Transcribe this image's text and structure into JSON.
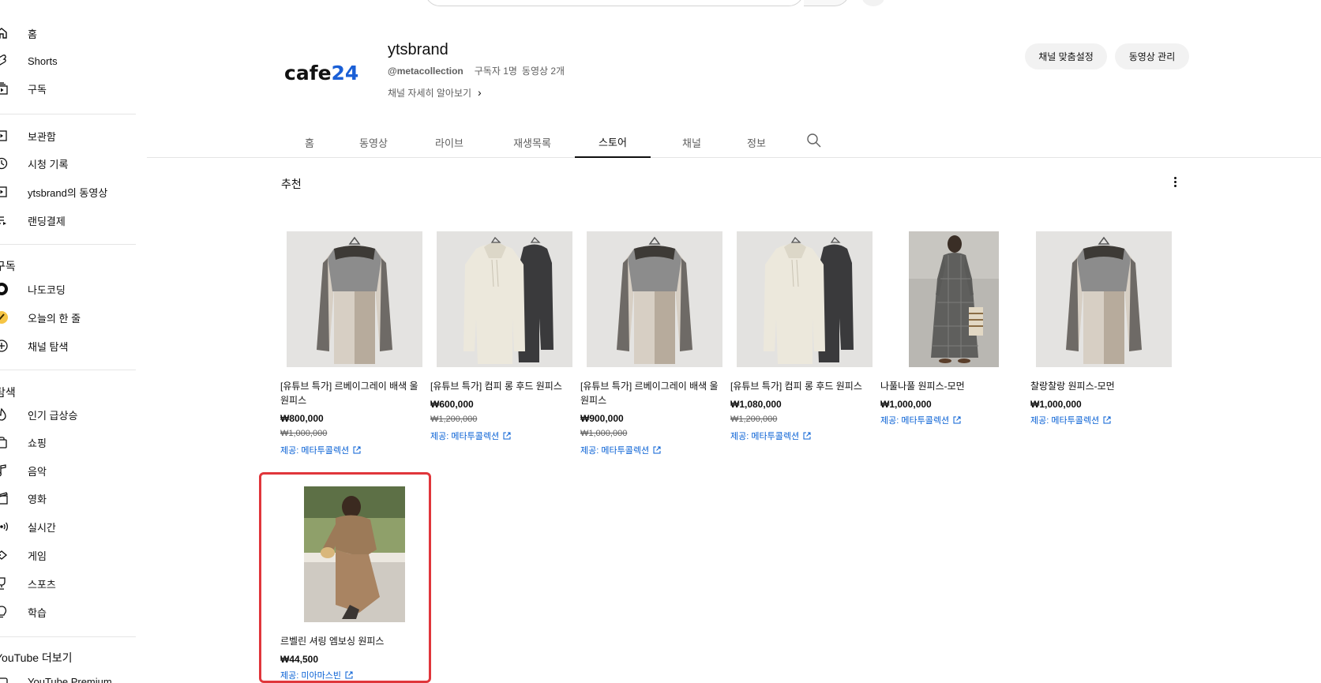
{
  "sidebar": {
    "nav": [
      {
        "label": "홈",
        "icon": "home-icon"
      },
      {
        "label": "Shorts",
        "icon": "shorts-icon"
      },
      {
        "label": "구독",
        "icon": "subscriptions-icon"
      }
    ],
    "library": [
      {
        "label": "보관함",
        "icon": "library-icon"
      },
      {
        "label": "시청 기록",
        "icon": "history-icon"
      },
      {
        "label": "ytsbrand의 동영상",
        "icon": "your-videos-icon"
      },
      {
        "label": "랜딩결제",
        "icon": "playlist-icon"
      }
    ],
    "subscriptions_title": "구독",
    "subscriptions": [
      {
        "label": "나도코딩",
        "icon": "channel-avatar-icon"
      },
      {
        "label": "오늘의 한 줄",
        "icon": "channel-avatar-icon"
      },
      {
        "label": "채널 탐색",
        "icon": "browse-channels-icon"
      }
    ],
    "explore_title": "탐색",
    "explore": [
      {
        "label": "인기 급상승",
        "icon": "trending-icon"
      },
      {
        "label": "쇼핑",
        "icon": "shopping-icon"
      },
      {
        "label": "음악",
        "icon": "music-icon"
      },
      {
        "label": "영화",
        "icon": "movies-icon"
      },
      {
        "label": "실시간",
        "icon": "live-icon"
      },
      {
        "label": "게임",
        "icon": "gaming-icon"
      },
      {
        "label": "스포츠",
        "icon": "sports-icon"
      },
      {
        "label": "학습",
        "icon": "learning-icon"
      }
    ],
    "more_title": "YouTube 더보기",
    "more": [
      {
        "label": "YouTube Premium",
        "icon": "premium-icon"
      }
    ]
  },
  "channel": {
    "logo_text": "cafe",
    "logo_num": "24",
    "name": "ytsbrand",
    "handle": "@metacollection",
    "subscribers": "구독자 1명",
    "videos": "동영상 2개",
    "more_info": "채널 자세히 알아보기",
    "customize_button": "채널 맞춤설정",
    "manage_videos_button": "동영상 관리"
  },
  "tabs": [
    {
      "label": "홈",
      "active": false
    },
    {
      "label": "동영상",
      "active": false
    },
    {
      "label": "라이브",
      "active": false
    },
    {
      "label": "재생목록",
      "active": false
    },
    {
      "label": "스토어",
      "active": true
    },
    {
      "label": "채널",
      "active": false
    },
    {
      "label": "정보",
      "active": false
    }
  ],
  "section": {
    "title": "추천"
  },
  "products": [
    {
      "title": "[유튜브 특가] 르베이그레이 배색 울 원피스",
      "price": "₩800,000",
      "old_price": "₩1,000,000",
      "vendor": "제공: 메타투콜렉션",
      "image": "gray-beige-knit-dress"
    },
    {
      "title": "[유튜브 특가] 컴피 롱 후드 원피스",
      "price": "₩600,000",
      "old_price": "₩1,200,000",
      "vendor": "제공: 메타투콜렉션",
      "image": "cream-black-hood-dresses"
    },
    {
      "title": "[유튜브 특가] 르베이그레이 배색 울 원피스",
      "price": "₩900,000",
      "old_price": "₩1,000,000",
      "vendor": "제공: 메타투콜렉션",
      "image": "gray-beige-knit-dress"
    },
    {
      "title": "[유튜브 특가] 컴피 롱 후드 원피스",
      "price": "₩1,080,000",
      "old_price": "₩1,200,000",
      "vendor": "제공: 메타투콜렉션",
      "image": "cream-black-hood-dresses"
    },
    {
      "title": "나풀나풀 원피스-모먼",
      "price": "₩1,000,000",
      "old_price": "",
      "vendor": "제공: 메타투콜렉션",
      "image": "checked-long-dress-model"
    },
    {
      "title": "찰랑찰랑 원피스-모먼",
      "price": "₩1,000,000",
      "old_price": "",
      "vendor": "제공: 메타투콜렉션",
      "image": "gray-beige-knit-dress"
    },
    {
      "title": "르벨린 셔링 엠보싱 원피스",
      "price": "₩44,500",
      "old_price": "",
      "vendor": "제공: 미아마스빈",
      "image": "brown-dress-seated-model"
    }
  ]
}
